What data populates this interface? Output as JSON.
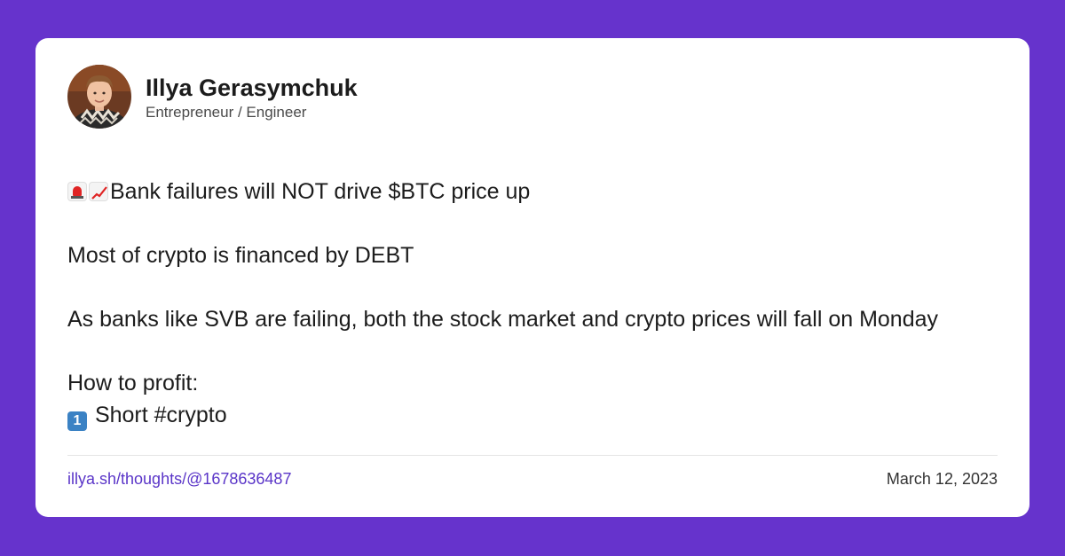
{
  "colors": {
    "background": "#6633cc",
    "card": "#ffffff",
    "link": "#5a35c8",
    "text": "#1c1c1c"
  },
  "author": {
    "name": "Illya Gerasymchuk",
    "title": "Entrepreneur / Engineer",
    "avatar_icon": "profile-photo"
  },
  "post": {
    "headline_icons": [
      "police-siren-icon",
      "chart-increasing-icon"
    ],
    "headline": "Bank failures will NOT drive $BTC price up",
    "paragraph_1": "Most of crypto is financed by DEBT",
    "paragraph_2": "As banks like SVB are failing, both the stock market and crypto prices will fall on Monday",
    "paragraph_3": "How to profit:",
    "list_item_1_icon": "keycap-1-icon",
    "list_item_1": "Short #crypto"
  },
  "footer": {
    "link": "illya.sh/thoughts/@1678636487",
    "date": "March 12, 2023"
  }
}
